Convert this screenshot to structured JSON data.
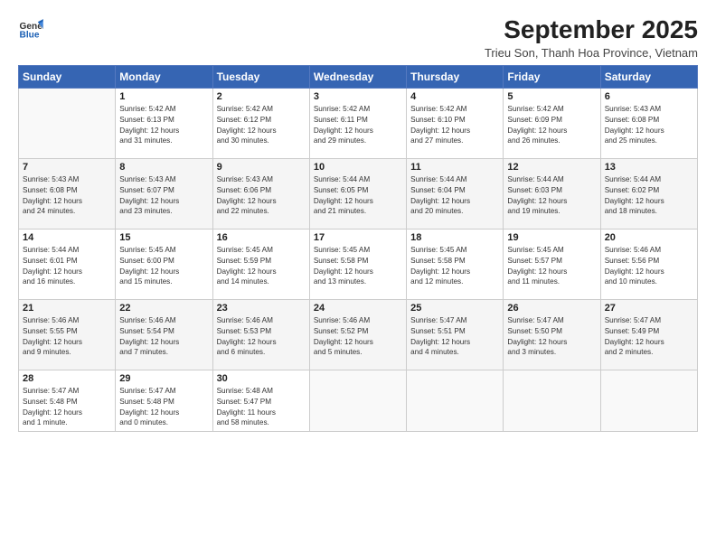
{
  "logo": {
    "line1": "General",
    "line2": "Blue"
  },
  "title": "September 2025",
  "subtitle": "Trieu Son, Thanh Hoa Province, Vietnam",
  "days_header": [
    "Sunday",
    "Monday",
    "Tuesday",
    "Wednesday",
    "Thursday",
    "Friday",
    "Saturday"
  ],
  "weeks": [
    [
      {
        "num": "",
        "lines": []
      },
      {
        "num": "1",
        "lines": [
          "Sunrise: 5:42 AM",
          "Sunset: 6:13 PM",
          "Daylight: 12 hours",
          "and 31 minutes."
        ]
      },
      {
        "num": "2",
        "lines": [
          "Sunrise: 5:42 AM",
          "Sunset: 6:12 PM",
          "Daylight: 12 hours",
          "and 30 minutes."
        ]
      },
      {
        "num": "3",
        "lines": [
          "Sunrise: 5:42 AM",
          "Sunset: 6:11 PM",
          "Daylight: 12 hours",
          "and 29 minutes."
        ]
      },
      {
        "num": "4",
        "lines": [
          "Sunrise: 5:42 AM",
          "Sunset: 6:10 PM",
          "Daylight: 12 hours",
          "and 27 minutes."
        ]
      },
      {
        "num": "5",
        "lines": [
          "Sunrise: 5:42 AM",
          "Sunset: 6:09 PM",
          "Daylight: 12 hours",
          "and 26 minutes."
        ]
      },
      {
        "num": "6",
        "lines": [
          "Sunrise: 5:43 AM",
          "Sunset: 6:08 PM",
          "Daylight: 12 hours",
          "and 25 minutes."
        ]
      }
    ],
    [
      {
        "num": "7",
        "lines": [
          "Sunrise: 5:43 AM",
          "Sunset: 6:08 PM",
          "Daylight: 12 hours",
          "and 24 minutes."
        ]
      },
      {
        "num": "8",
        "lines": [
          "Sunrise: 5:43 AM",
          "Sunset: 6:07 PM",
          "Daylight: 12 hours",
          "and 23 minutes."
        ]
      },
      {
        "num": "9",
        "lines": [
          "Sunrise: 5:43 AM",
          "Sunset: 6:06 PM",
          "Daylight: 12 hours",
          "and 22 minutes."
        ]
      },
      {
        "num": "10",
        "lines": [
          "Sunrise: 5:44 AM",
          "Sunset: 6:05 PM",
          "Daylight: 12 hours",
          "and 21 minutes."
        ]
      },
      {
        "num": "11",
        "lines": [
          "Sunrise: 5:44 AM",
          "Sunset: 6:04 PM",
          "Daylight: 12 hours",
          "and 20 minutes."
        ]
      },
      {
        "num": "12",
        "lines": [
          "Sunrise: 5:44 AM",
          "Sunset: 6:03 PM",
          "Daylight: 12 hours",
          "and 19 minutes."
        ]
      },
      {
        "num": "13",
        "lines": [
          "Sunrise: 5:44 AM",
          "Sunset: 6:02 PM",
          "Daylight: 12 hours",
          "and 18 minutes."
        ]
      }
    ],
    [
      {
        "num": "14",
        "lines": [
          "Sunrise: 5:44 AM",
          "Sunset: 6:01 PM",
          "Daylight: 12 hours",
          "and 16 minutes."
        ]
      },
      {
        "num": "15",
        "lines": [
          "Sunrise: 5:45 AM",
          "Sunset: 6:00 PM",
          "Daylight: 12 hours",
          "and 15 minutes."
        ]
      },
      {
        "num": "16",
        "lines": [
          "Sunrise: 5:45 AM",
          "Sunset: 5:59 PM",
          "Daylight: 12 hours",
          "and 14 minutes."
        ]
      },
      {
        "num": "17",
        "lines": [
          "Sunrise: 5:45 AM",
          "Sunset: 5:58 PM",
          "Daylight: 12 hours",
          "and 13 minutes."
        ]
      },
      {
        "num": "18",
        "lines": [
          "Sunrise: 5:45 AM",
          "Sunset: 5:58 PM",
          "Daylight: 12 hours",
          "and 12 minutes."
        ]
      },
      {
        "num": "19",
        "lines": [
          "Sunrise: 5:45 AM",
          "Sunset: 5:57 PM",
          "Daylight: 12 hours",
          "and 11 minutes."
        ]
      },
      {
        "num": "20",
        "lines": [
          "Sunrise: 5:46 AM",
          "Sunset: 5:56 PM",
          "Daylight: 12 hours",
          "and 10 minutes."
        ]
      }
    ],
    [
      {
        "num": "21",
        "lines": [
          "Sunrise: 5:46 AM",
          "Sunset: 5:55 PM",
          "Daylight: 12 hours",
          "and 9 minutes."
        ]
      },
      {
        "num": "22",
        "lines": [
          "Sunrise: 5:46 AM",
          "Sunset: 5:54 PM",
          "Daylight: 12 hours",
          "and 7 minutes."
        ]
      },
      {
        "num": "23",
        "lines": [
          "Sunrise: 5:46 AM",
          "Sunset: 5:53 PM",
          "Daylight: 12 hours",
          "and 6 minutes."
        ]
      },
      {
        "num": "24",
        "lines": [
          "Sunrise: 5:46 AM",
          "Sunset: 5:52 PM",
          "Daylight: 12 hours",
          "and 5 minutes."
        ]
      },
      {
        "num": "25",
        "lines": [
          "Sunrise: 5:47 AM",
          "Sunset: 5:51 PM",
          "Daylight: 12 hours",
          "and 4 minutes."
        ]
      },
      {
        "num": "26",
        "lines": [
          "Sunrise: 5:47 AM",
          "Sunset: 5:50 PM",
          "Daylight: 12 hours",
          "and 3 minutes."
        ]
      },
      {
        "num": "27",
        "lines": [
          "Sunrise: 5:47 AM",
          "Sunset: 5:49 PM",
          "Daylight: 12 hours",
          "and 2 minutes."
        ]
      }
    ],
    [
      {
        "num": "28",
        "lines": [
          "Sunrise: 5:47 AM",
          "Sunset: 5:48 PM",
          "Daylight: 12 hours",
          "and 1 minute."
        ]
      },
      {
        "num": "29",
        "lines": [
          "Sunrise: 5:47 AM",
          "Sunset: 5:48 PM",
          "Daylight: 12 hours",
          "and 0 minutes."
        ]
      },
      {
        "num": "30",
        "lines": [
          "Sunrise: 5:48 AM",
          "Sunset: 5:47 PM",
          "Daylight: 11 hours",
          "and 58 minutes."
        ]
      },
      {
        "num": "",
        "lines": []
      },
      {
        "num": "",
        "lines": []
      },
      {
        "num": "",
        "lines": []
      },
      {
        "num": "",
        "lines": []
      }
    ]
  ]
}
